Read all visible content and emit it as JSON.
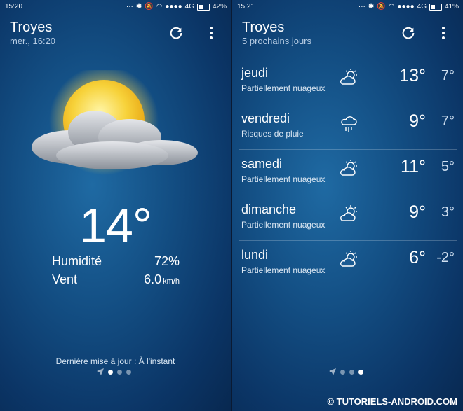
{
  "left": {
    "status": {
      "time": "15:20",
      "signal": "4G",
      "battery": "42%",
      "battery_fill": 0.42
    },
    "city": "Troyes",
    "datetime": "mer., 16:20",
    "temperature": "14°",
    "humidity_label": "Humidité",
    "humidity_value": "72%",
    "wind_label": "Vent",
    "wind_value": "6.0",
    "wind_unit": "km/h",
    "last_update": "Dernière mise à jour : À l'instant",
    "condition_icon": "sun-cloud-icon",
    "active_page": 1
  },
  "right": {
    "status": {
      "time": "15:21",
      "signal": "4G",
      "battery": "41%",
      "battery_fill": 0.41
    },
    "city": "Troyes",
    "subtitle": "5 prochains jours",
    "forecast": [
      {
        "day": "jeudi",
        "condition": "Partiellement nuageux",
        "icon": "partly-cloudy-icon",
        "high": "13°",
        "low": "7°"
      },
      {
        "day": "vendredi",
        "condition": "Risques de pluie",
        "icon": "rain-icon",
        "high": "9°",
        "low": "7°"
      },
      {
        "day": "samedi",
        "condition": "Partiellement nuageux",
        "icon": "partly-cloudy-icon",
        "high": "11°",
        "low": "5°"
      },
      {
        "day": "dimanche",
        "condition": "Partiellement nuageux",
        "icon": "partly-cloudy-icon",
        "high": "9°",
        "low": "3°"
      },
      {
        "day": "lundi",
        "condition": "Partiellement nuageux",
        "icon": "partly-cloudy-icon",
        "high": "6°",
        "low": "-2°"
      }
    ],
    "active_page": 3
  },
  "watermark": "© TUTORIELS-ANDROID.COM"
}
